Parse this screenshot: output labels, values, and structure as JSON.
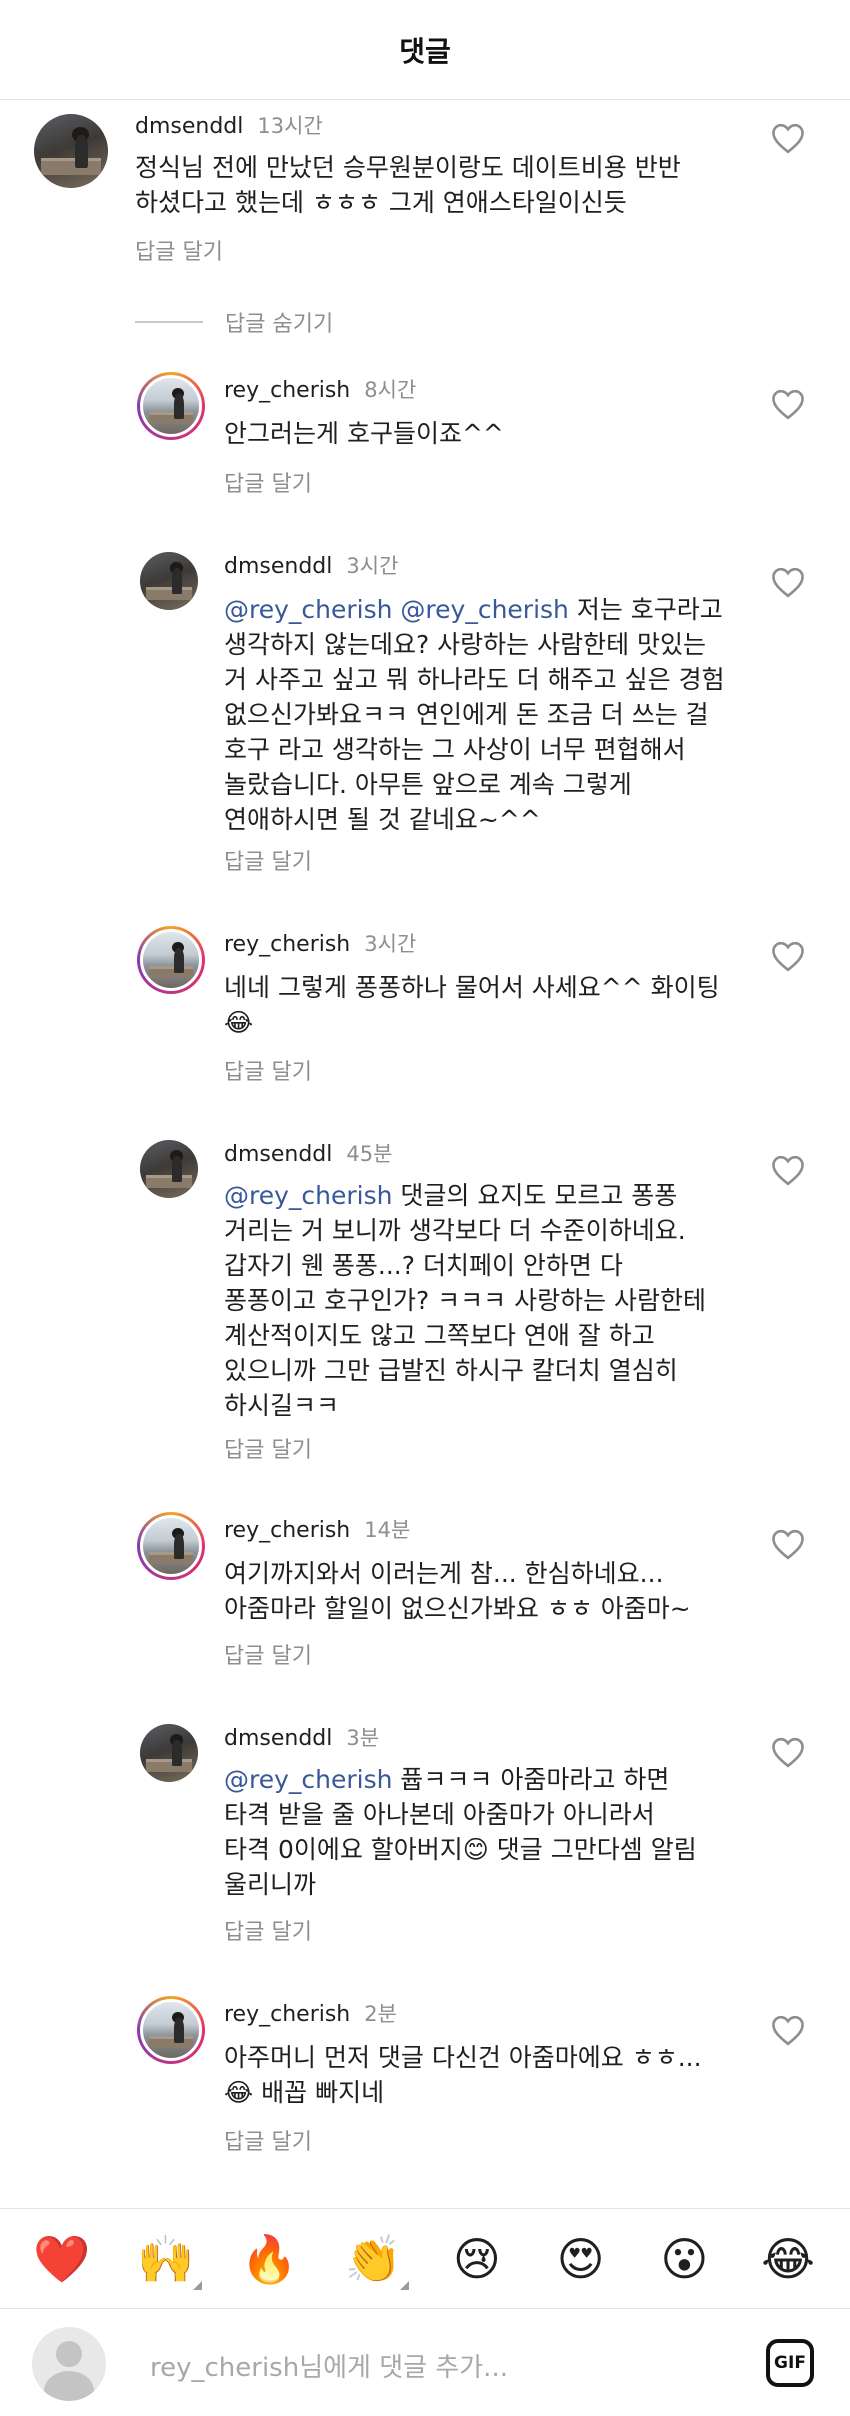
{
  "header": {
    "title": "댓글"
  },
  "comments": [
    {
      "username": "dmsenddl",
      "time": "13시간",
      "lines": [
        "정식님 전에 만났던 승무원분이랑도 데이트비용 반반",
        "하셨다고 했는데 ㅎㅎㅎ 그게 연애스타일이신듯"
      ],
      "reply_label": "답글 달기",
      "avatar": "dmsenddl-avatar"
    },
    {
      "username": "rey_cherish",
      "time": "8시간",
      "lines": [
        "안그러는게 호구들이죠^^"
      ],
      "reply_label": "답글 달기",
      "avatar": "rey-cherish-avatar"
    },
    {
      "username": "dmsenddl",
      "time": "3시간",
      "mention": "@rey_cherish @rey_cherish",
      "first_line_rest": " 저는 호구라고",
      "lines": [
        "생각하지 않는데요? 사랑하는 사람한테 맛있는",
        "거 사주고 싶고 뭐 하나라도 더 해주고 싶은 경험",
        "없으신가봐요ㅋㅋ 연인에게 돈 조금 더 쓰는 걸",
        "호구 라고 생각하는 그 사상이 너무 편협해서",
        "놀랐습니다. 아무튼 앞으로 계속 그렇게",
        "연애하시면 될 것 같네요~^^"
      ],
      "reply_label": "답글 달기",
      "avatar": "dmsenddl-avatar"
    },
    {
      "username": "rey_cherish",
      "time": "3시간",
      "lines": [
        "네네 그렇게 퐁퐁하나 물어서 사세요^^ 화이팅",
        "😂"
      ],
      "reply_label": "답글 달기",
      "avatar": "rey-cherish-avatar"
    },
    {
      "username": "dmsenddl",
      "time": "45분",
      "mention": "@rey_cherish",
      "first_line_rest": " 댓글의 요지도 모르고 퐁퐁",
      "lines": [
        "거리는 거 보니까 생각보다 더 수준이하네요.",
        "갑자기 웬 퐁퐁...? 더치페이 안하면 다",
        "퐁퐁이고 호구인가? ㅋㅋㅋ 사랑하는 사람한테",
        "계산적이지도 않고 그쪽보다 연애 잘 하고",
        "있으니까 그만 급발진 하시구 칼더치 열심히",
        "하시길ㅋㅋ"
      ],
      "reply_label": "답글 달기",
      "avatar": "dmsenddl-avatar"
    },
    {
      "username": "rey_cherish",
      "time": "14분",
      "lines": [
        "여기까지와서 이러는게 참... 한심하네요...",
        "아줌마라 할일이 없으신가봐요 ㅎㅎ 아줌마~"
      ],
      "reply_label": "답글 달기",
      "avatar": "rey-cherish-avatar"
    },
    {
      "username": "dmsenddl",
      "time": "3분",
      "mention": "@rey_cherish",
      "first_line_rest": " 퓹ㅋㅋㅋ 아줌마라고 하면",
      "lines": [
        "타격 받을 줄 아나본데 아줌마가 아니라서",
        "타격 0이에요 할아버지😊 댓글 그만다셈 알림",
        "울리니까"
      ],
      "reply_label": "답글 달기",
      "avatar": "dmsenddl-avatar"
    },
    {
      "username": "rey_cherish",
      "time": "2분",
      "lines": [
        "아주머니 먼저 댓글 다신건 아줌마에요 ㅎㅎ...",
        "😂 배꼽 빠지네"
      ],
      "reply_label": "답글 달기",
      "avatar": "rey-cherish-avatar"
    }
  ],
  "hide_replies_label": "답글 숨기기",
  "emoji_bar": [
    "❤️",
    "🙌",
    "🔥",
    "👏",
    "😢",
    "😍",
    "😮",
    "😂"
  ],
  "input": {
    "placeholder": "rey_cherish님에게 댓글 추가...",
    "gif_label": "GIF"
  },
  "colors": {
    "mention": "#385898",
    "muted": "#8e8e8e",
    "heart_outline": "#8e8e8e"
  }
}
